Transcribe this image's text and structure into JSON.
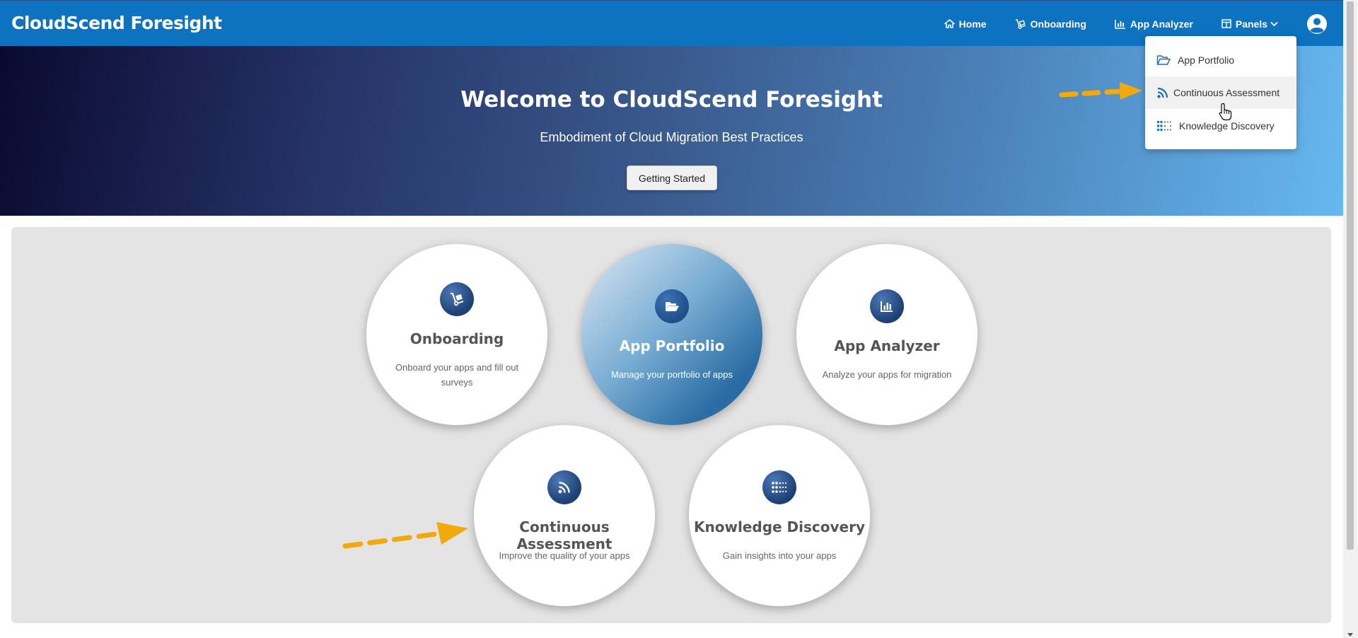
{
  "app": {
    "brand": "CloudScend Foresight"
  },
  "nav": {
    "home": "Home",
    "onboarding": "Onboarding",
    "app_analyzer": "App Analyzer",
    "panels": "Panels"
  },
  "hero": {
    "title": "Welcome to CloudScend Foresight",
    "subtitle": "Embodiment of Cloud Migration Best Practices",
    "cta": "Getting Started"
  },
  "cards": {
    "onboarding": {
      "title": "Onboarding",
      "desc": "Onboard your apps and fill out surveys",
      "icon": "dolly-icon"
    },
    "app_portfolio": {
      "title": "App Portfolio",
      "desc": "Manage your portfolio of apps",
      "icon": "folder-open-icon"
    },
    "app_analyzer": {
      "title": "App Analyzer",
      "desc": "Analyze your apps for migration",
      "icon": "bar-chart-icon"
    },
    "continuous_assessment": {
      "title": "Continuous Assessment",
      "desc": "Improve the quality of your apps",
      "icon": "rss-icon"
    },
    "knowledge_discovery": {
      "title": "Knowledge Discovery",
      "desc": "Gain insights into your apps",
      "icon": "dots-grid-icon"
    }
  },
  "panels_menu": {
    "items": [
      "App Portfolio",
      "Continuous Assessment",
      "Knowledge Discovery"
    ]
  },
  "colors": {
    "navbar": "#0d72bf",
    "annotation_arrow": "#f2a90c",
    "icon_blue": "#1f6db5"
  }
}
